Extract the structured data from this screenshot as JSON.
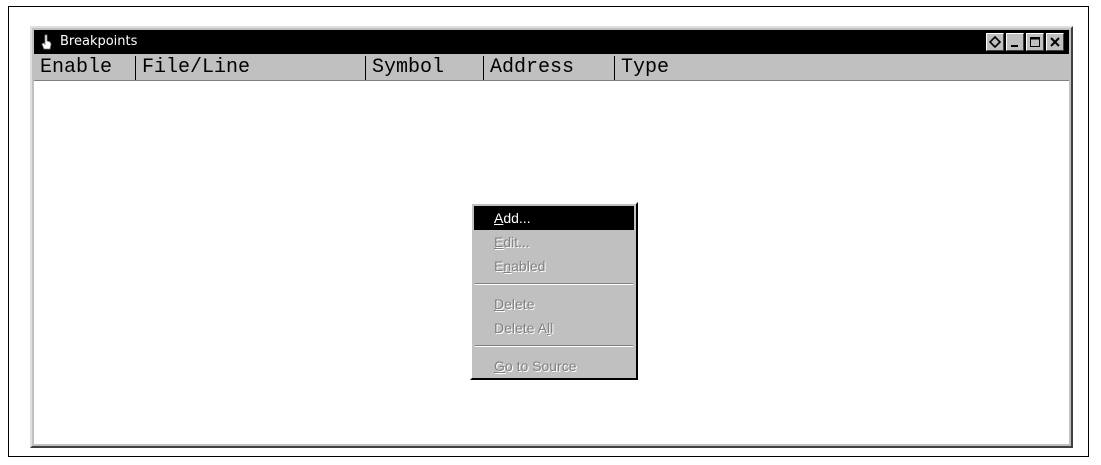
{
  "window": {
    "title": "Breakpoints"
  },
  "columns": [
    "Enable",
    "File/Line",
    "Symbol",
    "Address",
    "Type"
  ],
  "context_menu": {
    "items": [
      {
        "pre": "",
        "key": "A",
        "post": "dd...",
        "enabled": true
      },
      {
        "pre": "",
        "key": "E",
        "post": "dit...",
        "enabled": false
      },
      {
        "pre": "E",
        "key": "n",
        "post": "abled",
        "enabled": false
      },
      {
        "pre": "",
        "key": "D",
        "post": "elete",
        "enabled": false
      },
      {
        "pre": "Delete A",
        "key": "l",
        "post": "l",
        "enabled": false
      },
      {
        "pre": "",
        "key": "G",
        "post": "o to Source",
        "enabled": false
      }
    ]
  },
  "icons": {
    "app": "hand-pointer-icon",
    "pin": "diamond-pin-icon",
    "minimize": "minimize-icon",
    "maximize": "maximize-icon",
    "close": "close-icon"
  }
}
